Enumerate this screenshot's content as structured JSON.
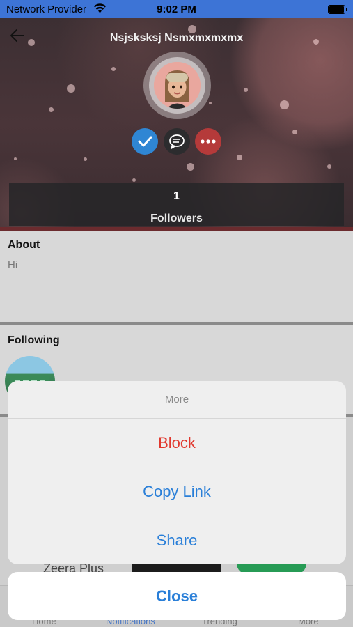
{
  "status_bar": {
    "carrier": "Network Provider",
    "time": "9:02 PM"
  },
  "profile": {
    "name": "Nsjsksksj Nsmxmxmxmx",
    "followers_count": "1",
    "followers_label": "Followers"
  },
  "about": {
    "title": "About",
    "text": "Hi"
  },
  "following": {
    "title": "Following"
  },
  "background_ad": {
    "text": "Zeera Plus"
  },
  "tabbar": {
    "tabs": [
      "Home",
      "Notifications",
      "Trending",
      "More"
    ]
  },
  "action_sheet": {
    "title": "More",
    "items": [
      {
        "label": "Block",
        "style": "destructive"
      },
      {
        "label": "Copy Link",
        "style": "default"
      },
      {
        "label": "Share",
        "style": "default"
      }
    ],
    "cancel_label": "Close"
  },
  "colors": {
    "status_bar": "#3d74d6",
    "accent_blue": "#2a7fd8",
    "destructive_red": "#e1382e",
    "check_button": "#2f86d4",
    "more_button": "#b53a3a"
  },
  "icons": {
    "back": "arrow-left-icon",
    "verified": "check-icon",
    "message": "chat-bubble-icon",
    "more": "ellipsis-icon",
    "wifi": "wifi-icon",
    "battery": "battery-icon"
  }
}
